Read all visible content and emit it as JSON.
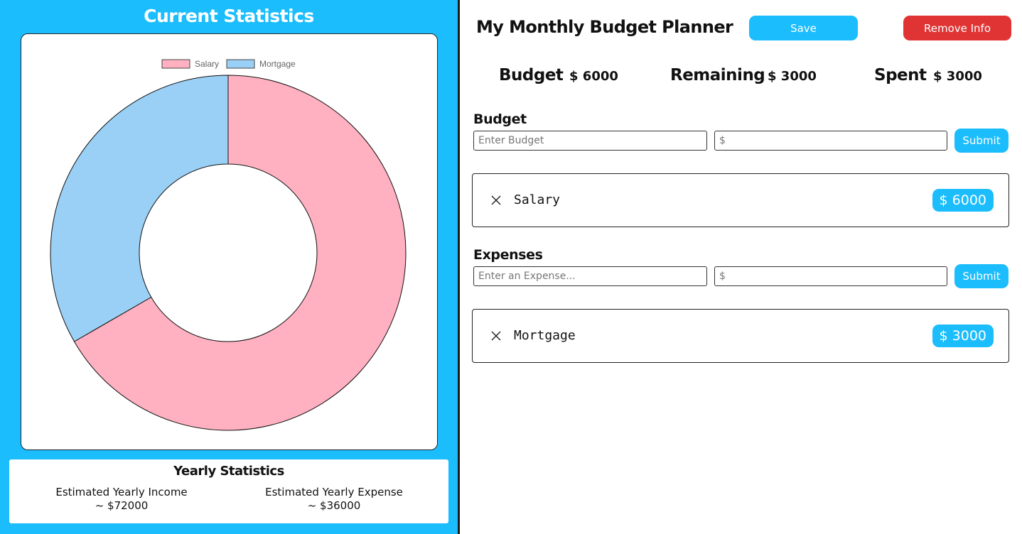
{
  "left": {
    "title": "Current Statistics",
    "yearly": {
      "title": "Yearly Statistics",
      "income_label": "Estimated Yearly Income",
      "income_value": "~ $72000",
      "expense_label": "Estimated Yearly Expense",
      "expense_value": "~ $36000"
    }
  },
  "chart_data": {
    "type": "pie",
    "subtype": "doughnut",
    "categories": [
      "Salary",
      "Mortgage"
    ],
    "values": [
      6000,
      3000
    ],
    "colors": [
      "#ffb1c1",
      "#9ad0f5"
    ],
    "border_colors": [
      "#ff6384",
      "#36a2eb"
    ],
    "legend_position": "top",
    "title": ""
  },
  "header": {
    "title": "My Monthly Budget Planner",
    "save_label": "Save",
    "remove_label": "Remove Info"
  },
  "summary": {
    "budget_label": "Budget",
    "budget_value": "$ 6000",
    "remaining_label": "Remaining",
    "remaining_value": "$ 3000",
    "spent_label": "Spent",
    "spent_value": "$ 3000"
  },
  "budget_section": {
    "heading": "Budget",
    "name_placeholder": "Enter Budget",
    "amount_placeholder": "$",
    "submit_label": "Submit",
    "items": [
      {
        "name": "Salary",
        "amount": "$ 6000"
      }
    ]
  },
  "expense_section": {
    "heading": "Expenses",
    "name_placeholder": "Enter an Expense...",
    "amount_placeholder": "$",
    "submit_label": "Submit",
    "items": [
      {
        "name": "Mortgage",
        "amount": "$ 3000"
      }
    ]
  },
  "colors": {
    "accent": "#1cbdfd",
    "danger": "#e03434"
  },
  "icons": {
    "remove_item": "close-icon"
  }
}
